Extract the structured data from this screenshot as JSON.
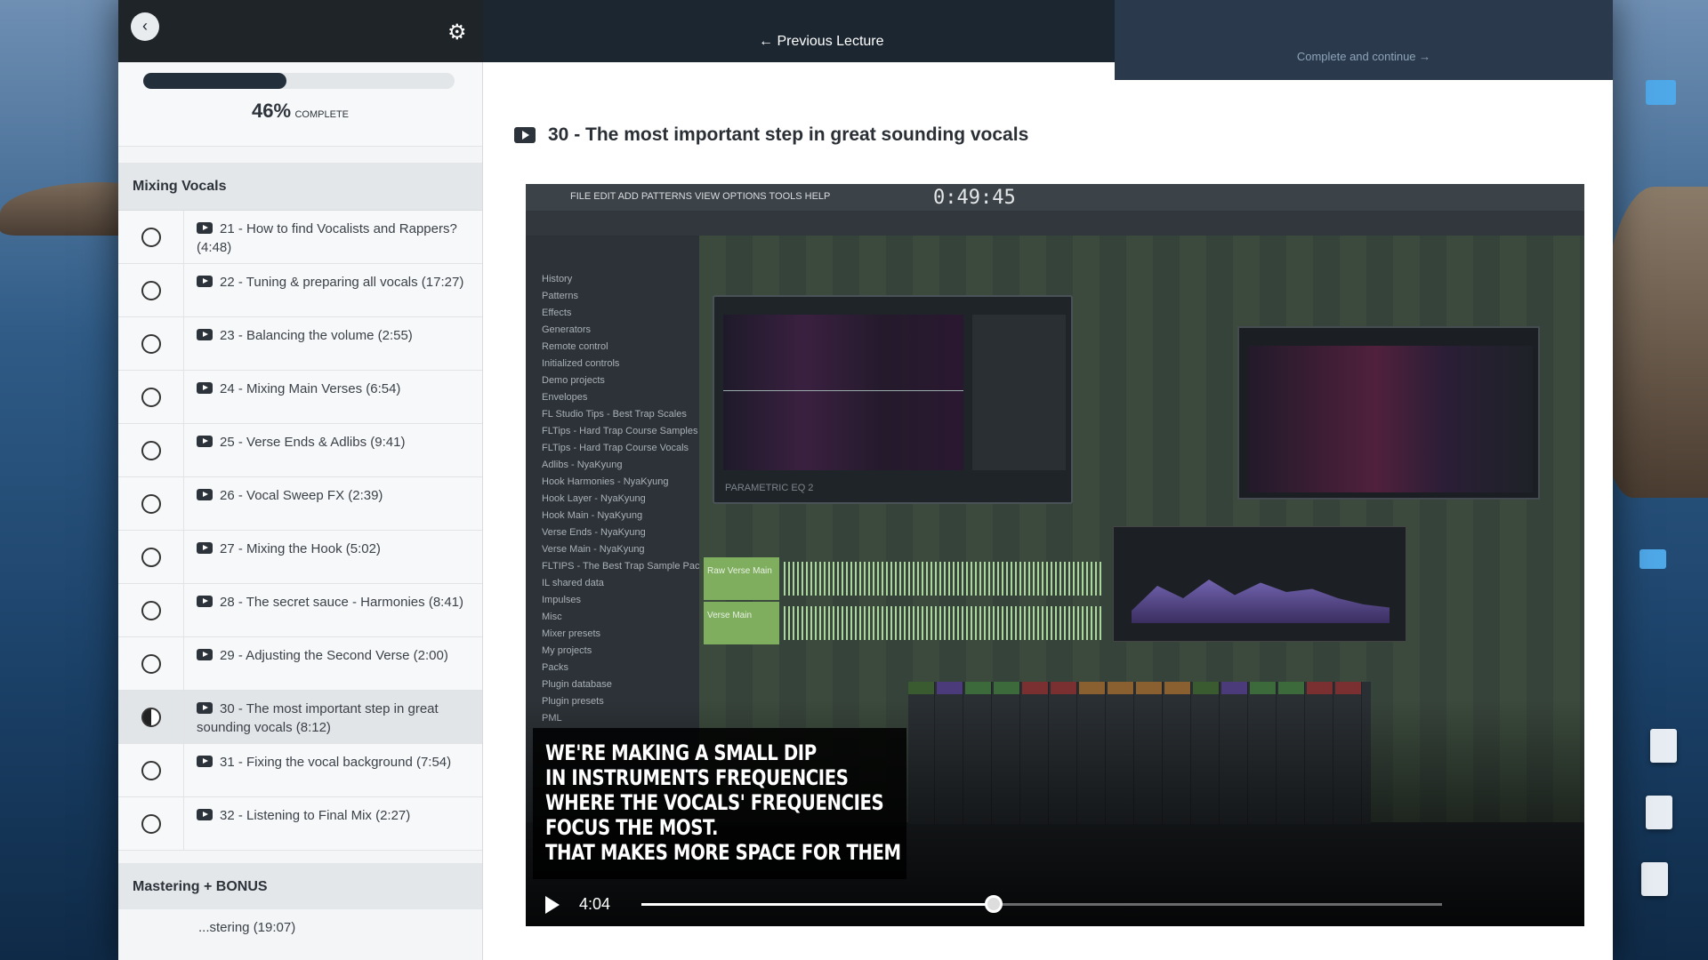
{
  "header": {
    "previous_lecture": "Previous Lecture",
    "complete_continue": "Complete and continue"
  },
  "progress": {
    "percent": "46%",
    "label": "COMPLETE",
    "fraction": 0.46
  },
  "section": {
    "title": "Mixing Vocals",
    "lectures": [
      {
        "title": "21 - How to find Vocalists and Rappers? (4:48)",
        "state": "incomplete"
      },
      {
        "title": "22 - Tuning & preparing all vocals (17:27)",
        "state": "incomplete"
      },
      {
        "title": "23 - Balancing the volume (2:55)",
        "state": "incomplete"
      },
      {
        "title": "24 - Mixing Main Verses (6:54)",
        "state": "incomplete"
      },
      {
        "title": "25 - Verse Ends & Adlibs (9:41)",
        "state": "incomplete"
      },
      {
        "title": "26 - Vocal Sweep FX (2:39)",
        "state": "incomplete"
      },
      {
        "title": "27 - Mixing the Hook (5:02)",
        "state": "incomplete"
      },
      {
        "title": "28 - The secret sauce - Harmonies (8:41)",
        "state": "incomplete"
      },
      {
        "title": "29 - Adjusting the Second Verse (2:00)",
        "state": "incomplete"
      },
      {
        "title": "30 - The most important step in great sounding vocals (8:12)",
        "state": "in-progress"
      },
      {
        "title": "31 - Fixing the vocal background (7:54)",
        "state": "incomplete"
      },
      {
        "title": "32 - Listening to Final Mix (2:27)",
        "state": "incomplete"
      }
    ]
  },
  "next_section": {
    "title": "Mastering + BONUS",
    "partial_item": "...stering (19:07)"
  },
  "lecture": {
    "heading": "30 - The most important step in great sounding vocals"
  },
  "video": {
    "fl_menu": "FILE  EDIT  ADD  PATTERNS  VIEW  OPTIONS  TOOLS  HELP",
    "fl_time": "0:49:45",
    "browser_items": [
      "History",
      "Patterns",
      "Effects",
      "Generators",
      "Remote control",
      "Initialized controls",
      "Demo projects",
      "Envelopes",
      "FL Studio Tips - Best Trap Scales",
      "FLTips - Hard Trap Course Samples",
      "FLTips - Hard Trap Course Vocals",
      "Adlibs - NyaKyung",
      "Hook Harmonies - NyaKyung",
      "Hook Layer - NyaKyung",
      "Hook Main - NyaKyung",
      "Verse Ends - NyaKyung",
      "Verse Main - NyaKyung",
      "FLTIPS - The Best Trap Sample Pack",
      "IL shared data",
      "Impulses",
      "Misc",
      "Mixer presets",
      "My projects",
      "Packs",
      "Plugin database",
      "Plugin presets",
      "PML"
    ],
    "track_labels": [
      "Raw Verse Main",
      "Verse Main"
    ],
    "eq_label": "PARAMETRIC EQ 2",
    "subtitles": [
      "We're making a small dip",
      "in instruments frequencies",
      "where the vocals' frequencies",
      "focus the most.",
      "That makes more space for them"
    ],
    "current_time": "4:04",
    "progress_fraction": 0.44
  }
}
